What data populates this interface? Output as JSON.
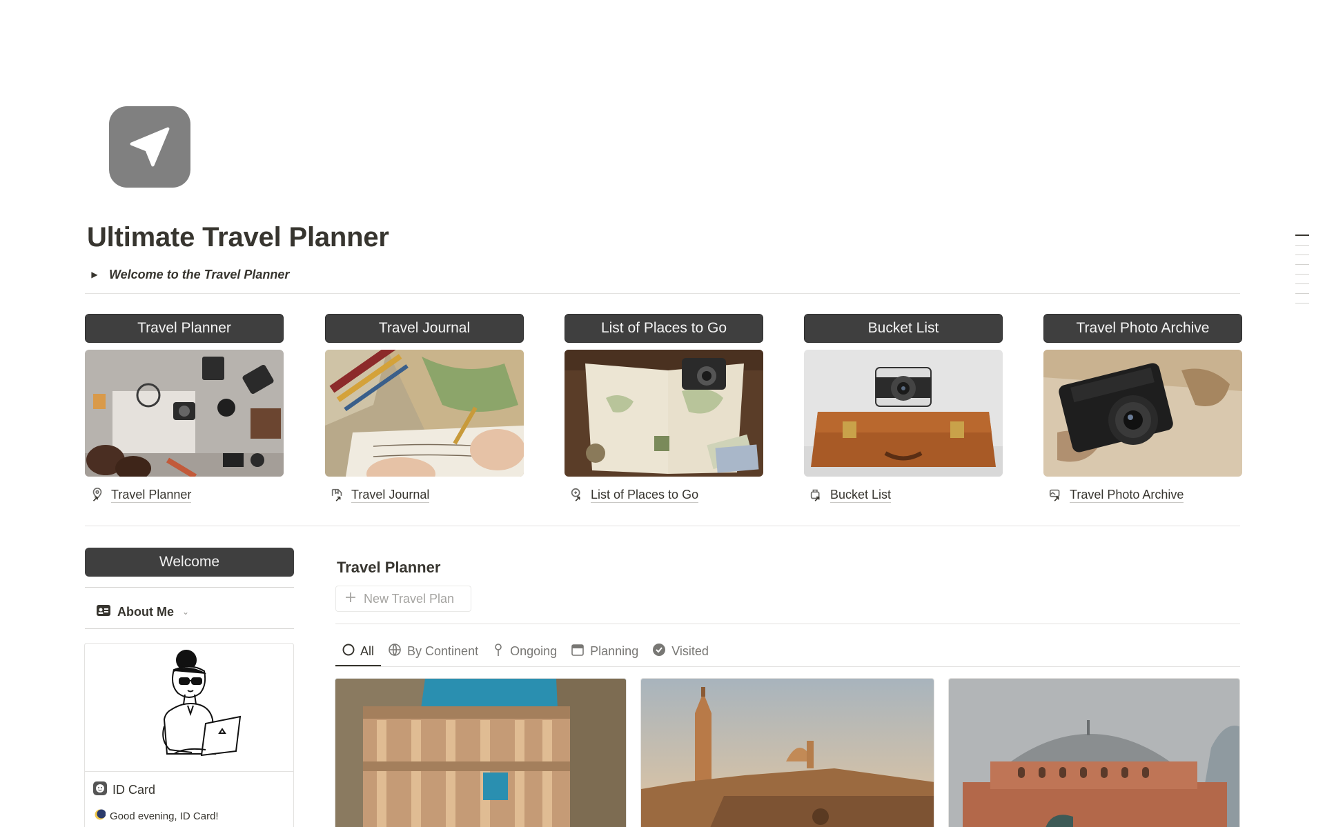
{
  "page": {
    "icon": "paper-plane-icon",
    "title": "Ultimate Travel Planner",
    "toggle_label": "Welcome to the Travel Planner"
  },
  "cards": [
    {
      "header": "Travel Planner",
      "link": "Travel Planner",
      "icon": "map-pin-link-icon"
    },
    {
      "header": "Travel Journal",
      "link": "Travel Journal",
      "icon": "journal-link-icon"
    },
    {
      "header": "List of Places to Go",
      "link": "List of Places to Go",
      "icon": "search-map-link-icon"
    },
    {
      "header": "Bucket List",
      "link": "Bucket List",
      "icon": "bag-link-icon"
    },
    {
      "header": "Travel Photo Archive",
      "link": "Travel Photo Archive",
      "icon": "photo-link-icon"
    }
  ],
  "sidebar": {
    "welcome_header": "Welcome",
    "about_label": "About Me",
    "id_card": {
      "title": "ID Card",
      "greeting": "Good evening, ID Card!"
    }
  },
  "database": {
    "title": "Travel Planner",
    "new_button": "New Travel Plan",
    "tabs": [
      {
        "label": "All",
        "icon": "circle-icon",
        "active": true
      },
      {
        "label": "By Continent",
        "icon": "globe-icon",
        "active": false
      },
      {
        "label": "Ongoing",
        "icon": "pin-icon",
        "active": false
      },
      {
        "label": "Planning",
        "icon": "calendar-icon",
        "active": false
      },
      {
        "label": "Visited",
        "icon": "check-circle-icon",
        "active": false
      }
    ]
  },
  "colors": {
    "header_bg": "#3f3f3f",
    "text": "#37352f",
    "muted": "#787774",
    "icon_bg": "#808080"
  }
}
